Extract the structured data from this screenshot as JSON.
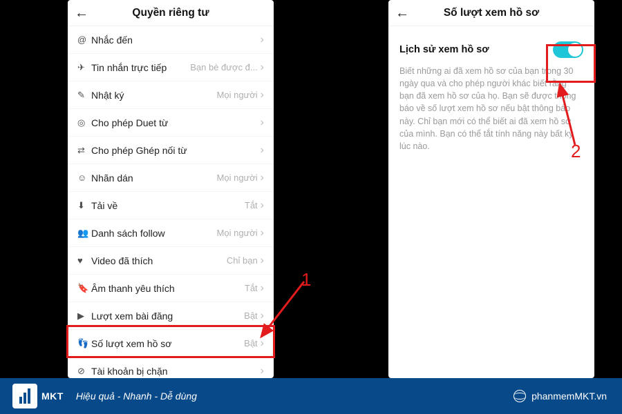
{
  "left": {
    "title": "Quyền riêng tư",
    "rows": [
      {
        "icon": "@",
        "label": "Nhắc đến",
        "value": ""
      },
      {
        "icon": "✈",
        "label": "Tin nhắn trực tiếp",
        "value": "Bạn bè được đ..."
      },
      {
        "icon": "✎",
        "label": "Nhật ký",
        "value": "Mọi người"
      },
      {
        "icon": "◎",
        "label": "Cho phép Duet từ",
        "value": ""
      },
      {
        "icon": "⇄",
        "label": "Cho phép Ghép nối từ",
        "value": ""
      },
      {
        "icon": "☺",
        "label": "Nhãn dán",
        "value": "Mọi người"
      },
      {
        "icon": "⬇",
        "label": "Tải về",
        "value": "Tắt"
      },
      {
        "icon": "👥",
        "label": "Danh sách follow",
        "value": "Mọi người"
      },
      {
        "icon": "♥",
        "label": "Video đã thích",
        "value": "Chỉ bạn"
      },
      {
        "icon": "🔖",
        "label": "Âm thanh yêu thích",
        "value": "Tắt"
      },
      {
        "icon": "▶",
        "label": "Lượt xem bài đăng",
        "value": "Bật"
      },
      {
        "icon": "👣",
        "label": "Số lượt xem hồ sơ",
        "value": "Bật"
      },
      {
        "icon": "⊘",
        "label": "Tài khoản bị chặn",
        "value": ""
      }
    ]
  },
  "right": {
    "title": "Số lượt xem hồ sơ",
    "toggle_label": "Lịch sử xem hồ sơ",
    "description": "Biết những ai đã xem hồ sơ của bạn trong 30 ngày qua và cho phép người khác biết rằng bạn đã xem hồ sơ của họ. Bạn sẽ được thông báo về số lượt xem hồ sơ nếu bật thông báo này. Chỉ bạn mới có thể biết ai đã xem hồ sơ của mình. Bạn có thể tắt tính năng này bất kỳ lúc nào."
  },
  "annotations": {
    "n1": "1",
    "n2": "2"
  },
  "footer": {
    "brand": "MKT",
    "tagline": "Hiệu quả - Nhanh - Dễ dùng",
    "site": "phanmemMKT.vn"
  }
}
